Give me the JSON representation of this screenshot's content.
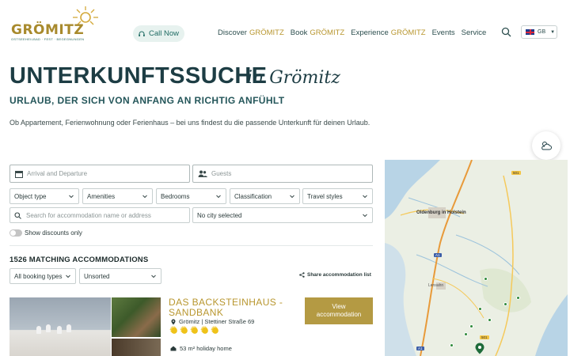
{
  "header": {
    "logo_text": "GRÖMITZ",
    "logo_tagline": "OSTSEEHEILBAD · FEST · BEGEGNUNGEN",
    "call_label": "Call Now",
    "nav": [
      {
        "pre": "Discover",
        "accent": "GRÖMITZ"
      },
      {
        "pre": "Book",
        "accent": "GRÖMITZ"
      },
      {
        "pre": "Experience",
        "accent": "GRÖMITZ"
      },
      {
        "pre": "Events",
        "accent": ""
      },
      {
        "pre": "Service",
        "accent": ""
      }
    ],
    "lang_code": "GB"
  },
  "hero": {
    "title": "UNTERKUNFTSSUCHE",
    "title_script": "in Grömitz",
    "subtitle": "URLAUB, DER SICH VON ANFANG AN RICHTIG ANFÜHLT",
    "intro": "Ob Appartement, Ferienwohnung oder Ferienhaus – bei uns findest du die passende Unterkunft für deinen Urlaub."
  },
  "filters": {
    "dates_placeholder": "Arrival and Departure",
    "guests_placeholder": "Guests",
    "selects": [
      "Object type",
      "Amenities",
      "Bedrooms",
      "Classification",
      "Travel styles"
    ],
    "search_placeholder": "Search for accommodation name or address",
    "city_value": "No city selected",
    "discounts_label": "Show discounts only"
  },
  "results": {
    "count_label": "1526 MATCHING ACCOMMODATIONS",
    "booking_type": "All booking types",
    "sort": "Unsorted",
    "share_label": "Share accommodation list"
  },
  "listing": {
    "title": "DAS BACKSTEINHAUS - SANDBANK",
    "address": "Grömitz | Stettiner Straße 69",
    "rating_suns": 5,
    "size": "53 m² holiday home",
    "view_button": "View accommodation"
  },
  "map": {
    "city": "Oldenburg in Holstein",
    "town": "Lensahn",
    "road_a1": "A1",
    "road_501": "501"
  },
  "colors": {
    "brand_gold": "#b8962e",
    "brand_dark": "#1d3d44",
    "button_gold": "#b49a43"
  }
}
